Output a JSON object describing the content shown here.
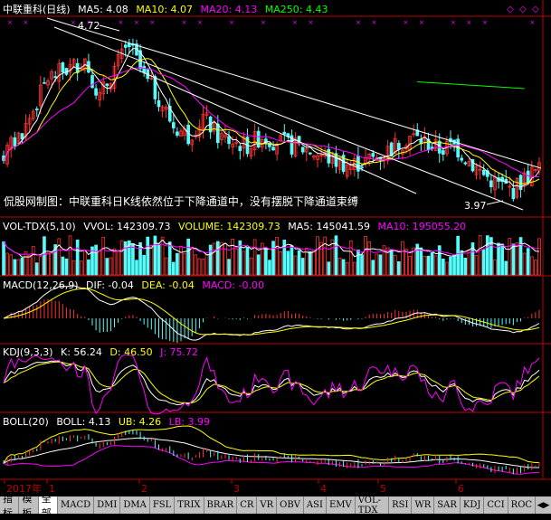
{
  "title": "中联重科(日线)",
  "colors": {
    "up": "#ff3232",
    "down": "#54fcfc",
    "ma5": "#ffffff",
    "ma10": "#ffff00",
    "ma20": "#ff00ff",
    "ma250": "#00ff00",
    "grid": "#800000",
    "axis": "#c00000"
  },
  "price_legend": {
    "ma5": "MA5: 4.08",
    "ma10": "MA10: 4.07",
    "ma20": "MA20: 4.13",
    "ma250": "MA250: 4.43"
  },
  "annotation": "侃股网制图：中联重科日K线依然位于下降通道中，没有摆脱下降通道束缚",
  "high_label": "4.72",
  "low_label": "3.97",
  "vol_legend": {
    "name": "VOL-TDX(5,10)",
    "vvol": "VVOL: 142309.73",
    "volume": "VOLUME: 142309.73",
    "ma5": "MA5: 145041.59",
    "ma10": "MA10: 195055.20"
  },
  "macd_legend": {
    "name": "MACD(12,26,9)",
    "dif": "DIF: -0.04",
    "dea": "DEA: -0.04",
    "macd": "MACD: -0.00"
  },
  "kdj_legend": {
    "name": "KDJ(9,3,3)",
    "k": "K: 56.24",
    "d": "D: 46.50",
    "j": "J: 75.72"
  },
  "boll_legend": {
    "name": "BOLL(20)",
    "boll": "BOLL: 4.13",
    "ub": "UB: 4.26",
    "lb": "LB: 3.99"
  },
  "axis_labels": [
    "2017年",
    "1",
    "2",
    "3",
    "4",
    "5",
    "6"
  ],
  "tabs": [
    "指标",
    "模板",
    "全部",
    "MACD",
    "DMI",
    "DMA",
    "FSL",
    "TRIX",
    "BRAR",
    "CR",
    "VR",
    "OBV",
    "ASI",
    "EMV",
    "VOL-TDX",
    "RSI",
    "WR",
    "SAR",
    "KDJ",
    "CCI",
    "ROC"
  ],
  "active_tab": "全部",
  "chart_data": {
    "type": "candlestick",
    "price_range": [
      3.85,
      4.85
    ],
    "anchor_points": [
      [
        0,
        4.15
      ],
      [
        6,
        4.3
      ],
      [
        12,
        4.55
      ],
      [
        18,
        4.6
      ],
      [
        22,
        4.65
      ],
      [
        26,
        4.45
      ],
      [
        30,
        4.6
      ],
      [
        34,
        4.72
      ],
      [
        38,
        4.55
      ],
      [
        42,
        4.45
      ],
      [
        46,
        4.3
      ],
      [
        50,
        4.25
      ],
      [
        54,
        4.35
      ],
      [
        58,
        4.25
      ],
      [
        62,
        4.22
      ],
      [
        66,
        4.2
      ],
      [
        70,
        4.25
      ],
      [
        74,
        4.22
      ],
      [
        78,
        4.2
      ],
      [
        82,
        4.18
      ],
      [
        86,
        4.15
      ],
      [
        90,
        4.12
      ],
      [
        94,
        4.1
      ],
      [
        98,
        4.12
      ],
      [
        102,
        4.15
      ],
      [
        106,
        4.2
      ],
      [
        110,
        4.25
      ],
      [
        114,
        4.22
      ],
      [
        118,
        4.18
      ],
      [
        122,
        4.2
      ],
      [
        126,
        4.12
      ],
      [
        130,
        4.05
      ],
      [
        134,
        4.0
      ],
      [
        138,
        3.97
      ],
      [
        142,
        4.05
      ],
      [
        146,
        4.08
      ]
    ],
    "bar_count": 146
  }
}
